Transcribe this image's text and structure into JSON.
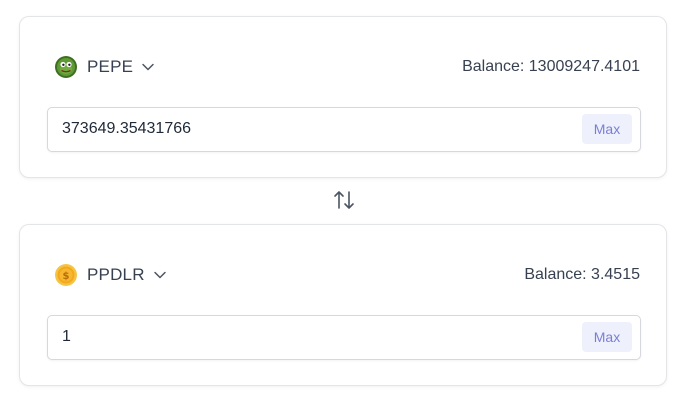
{
  "from": {
    "token_symbol": "PEPE",
    "token_icon": "pepe-frog-icon",
    "balance_text": "Balance: 13009247.4101",
    "amount_value": "373649.35431766",
    "max_label": "Max"
  },
  "to": {
    "token_symbol": "PPDLR",
    "token_icon": "gold-coin-icon",
    "balance_text": "Balance: 3.4515",
    "amount_value": "1",
    "max_label": "Max"
  },
  "swap": {
    "icon": "swap-arrows-icon"
  },
  "colors": {
    "max_text": "#7a7fd6",
    "max_background": "#eef0fb",
    "card_border": "#e3e5e8",
    "pepe_green": "#4f8a2c",
    "coin_gold": "#f2a91c"
  }
}
